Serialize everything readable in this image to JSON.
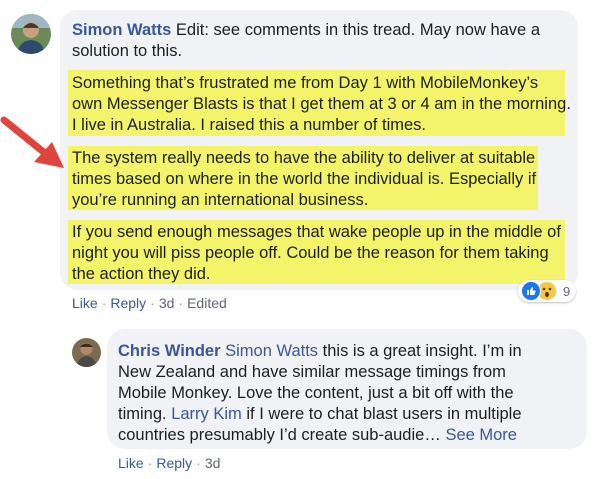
{
  "comment": {
    "author": "Simon Watts",
    "edit_text": "Edit: see comments in this tread. May now have a",
    "edit_text_2": "solution to this.",
    "p1": [
      "Something that’s frustrated me from Day 1 with MobileMonkey’s",
      "own Messenger Blasts is that I get them at 3 or 4 am in the morning.",
      "I live in Australia. I raised this a number of times."
    ],
    "p2": [
      "The system really needs to have the ability to deliver at suitable",
      "times based on where in the world the individual is. Especially if",
      "you’re running an international business."
    ],
    "p3": [
      "If you send enough messages that wake people up in the middle of",
      "night you will piss people off. Could be the reason for them taking",
      "the action they did."
    ],
    "reaction_count": "9",
    "actions": {
      "like": "Like",
      "reply": "Reply",
      "time": "3d",
      "edited": "Edited"
    }
  },
  "reply": {
    "author": "Chris Winder",
    "mention1": "Simon Watts",
    "line1_rest": "this is a great insight. I’m in",
    "line2": "New Zealand and have similar message timings from",
    "line3": "Mobile Monkey. Love the content, just a bit off with the",
    "line4_pre": "timing.",
    "mention2": "Larry Kim",
    "line4_rest": "if I were to chat blast users in multiple",
    "line5": "countries presumably I’d create sub-audie…",
    "see_more": "See More",
    "actions": {
      "like": "Like",
      "reply": "Reply",
      "time": "3d"
    }
  },
  "colors": {
    "highlight": "#f4f46a",
    "link": "#385898",
    "bubble": "#f0f2f5",
    "arrow": "#e0453b"
  }
}
